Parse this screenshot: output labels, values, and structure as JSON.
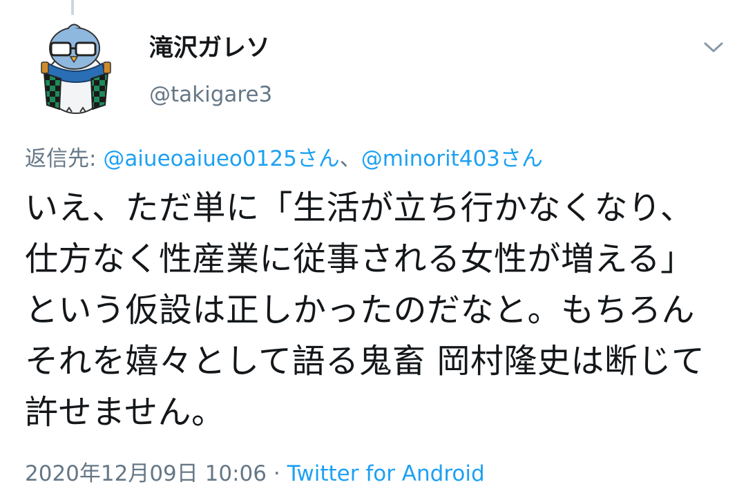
{
  "user": {
    "display_name": "滝沢ガレソ",
    "handle": "@takigare3"
  },
  "reply": {
    "prefix": "返信先:",
    "mention1": "@aiueoaiueo0125さん",
    "separator": "、",
    "mention2": "@minorit403さん"
  },
  "tweet": {
    "text": "いえ、ただ単に「生活が立ち行かなくなり、仕方なく性産業に従事される女性が増える」という仮設は正しかったのだなと。もちろんそれを嬉々として語る鬼畜 岡村隆史は断じて許せません。"
  },
  "meta": {
    "timestamp": "2020年12月09日 10:06",
    "dot": "·",
    "source": "Twitter for Android"
  },
  "icons": {
    "caret": "chevron-down-icon",
    "avatar": "bird-avatar"
  },
  "colors": {
    "link": "#1da1f2",
    "secondary": "#657786",
    "text": "#14171a"
  }
}
